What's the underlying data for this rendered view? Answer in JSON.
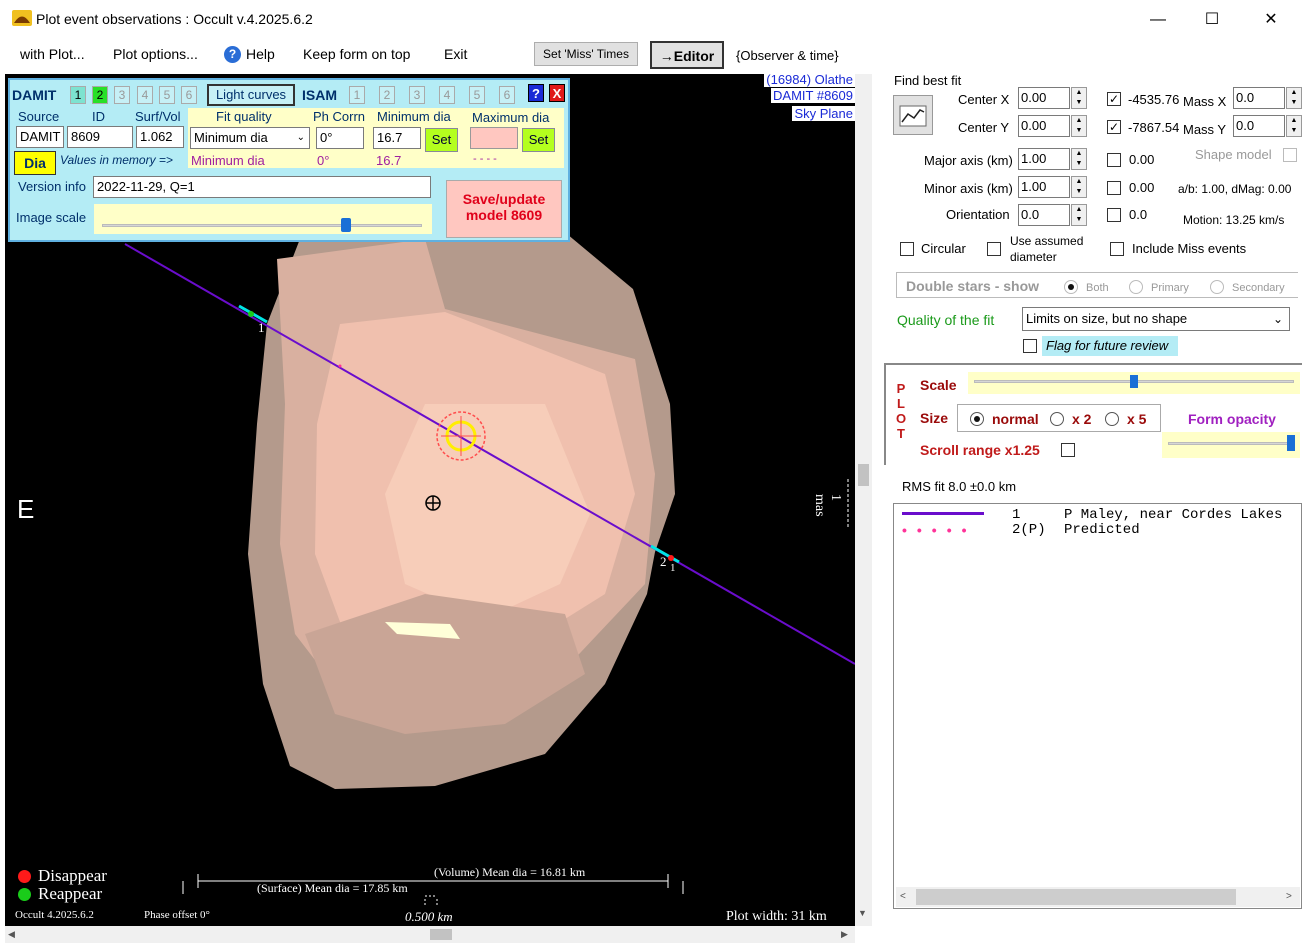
{
  "window": {
    "title": "Plot event observations : Occult v.4.2025.6.2",
    "minimize": "—",
    "maximize": "☐",
    "close": "✕"
  },
  "menu": {
    "with_plot": "with Plot...",
    "plot_options": "Plot options...",
    "help": "Help",
    "keep_form": "Keep form on top",
    "exit": "Exit",
    "set_miss": "Set 'Miss' Times",
    "editor": "→Editor",
    "observer_time": "{Observer & time}"
  },
  "plot": {
    "asteroid_label": "(16984) Olathe",
    "model_label": "DAMIT #8609",
    "plane_label": "Sky Plane",
    "direction_e": "E",
    "mas_label": "1 mas",
    "legend_disappear": "Disappear",
    "legend_reappear": "Reappear",
    "version": "Occult 4.2025.6.2",
    "phase_offset": "Phase offset 0°",
    "volume_dia": "(Volume) Mean dia = 16.81 km",
    "surface_dia": "(Surface) Mean dia = 17.85 km",
    "scale_km": "0.500 km",
    "plot_width": "Plot width: 31 km",
    "chord1_label": "1",
    "chord2_label": "2",
    "chord2_label_b": "1",
    "colors": {
      "disappear": "#ff1a1a",
      "reappear": "#1acc1a",
      "chord": "#6a0dcc"
    }
  },
  "panel": {
    "damit": "DAMIT",
    "isam": "ISAM",
    "nums": [
      "1",
      "2",
      "3",
      "4",
      "5",
      "6"
    ],
    "light_curves": "Light curves",
    "help": "?",
    "close": "X",
    "source_label": "Source",
    "id_label": "ID",
    "surfvol_label": "Surf/Vol",
    "source_value": "DAMIT",
    "id_value": "8609",
    "surfvol_value": "1.062",
    "fit_quality_label": "Fit quality",
    "ph_corrn_label": "Ph Corrn",
    "min_dia_label": "Minimum dia",
    "max_dia_label": "Maximum dia",
    "fit_quality_value": "Minimum dia",
    "ph_corrn_value": "0°",
    "min_dia_value": "16.7",
    "set_label": "Set",
    "dia_button": "Dia",
    "values_in_memory": "Values in memory =>",
    "mem_fit_quality": "Minimum dia",
    "mem_ph_corrn": "0°",
    "mem_min_dia": "16.7",
    "mem_max_dia": "- - - -",
    "version_info_label": "Version info",
    "version_info_value": "2022-11-29, Q=1",
    "image_scale_label": "Image scale",
    "save_update": "Save/update model 8609",
    "image_scale_level": 0.76
  },
  "right": {
    "find_best_fit": "Find best fit",
    "center_x_label": "Center X",
    "center_y_label": "Center Y",
    "center_x_value": "0.00",
    "center_y_value": "0.00",
    "fit_x_value": "-4535.76",
    "fit_y_value": "-7867.54",
    "mass_x_label": "Mass X",
    "mass_y_label": "Mass Y",
    "mass_x_value": "0.0",
    "mass_y_value": "0.0",
    "major_axis_label": "Major axis (km)",
    "minor_axis_label": "Minor axis (km)",
    "orientation_label": "Orientation",
    "major_axis_value": "1.00",
    "minor_axis_value": "1.00",
    "orientation_value": "0.0",
    "major_chk_value": "0.00",
    "minor_chk_value": "0.00",
    "orient_chk_value": "0.0",
    "shape_model_label": "Shape model",
    "ab_dmag": "a/b: 1.00, dMag: 0.00",
    "motion": "Motion: 13.25 km/s",
    "circular_label": "Circular",
    "use_assumed_label": "Use assumed diameter",
    "include_miss_label": "Include Miss events",
    "double_stars": "Double stars - show",
    "both": "Both",
    "primary": "Primary",
    "secondary": "Secondary",
    "quality_label": "Quality of the fit",
    "quality_value": "Limits on size, but no shape",
    "flag_review": "Flag for future review",
    "plot_letters": [
      "P",
      "L",
      "O",
      "T"
    ],
    "scale_label": "Scale",
    "size_label": "Size",
    "size_normal": "normal",
    "size_x2": "x 2",
    "size_x5": "x 5",
    "form_opacity": "Form opacity",
    "scroll_range": "Scroll range x1.25",
    "rms_fit": "RMS fit 8.0 ±0.0 km",
    "scale_level": 0.5,
    "opacity_level": 0.98,
    "obs": [
      {
        "num": "1",
        "name": "P Maley, near Cordes Lakes"
      },
      {
        "num": "2(P)",
        "name": "Predicted"
      }
    ]
  }
}
